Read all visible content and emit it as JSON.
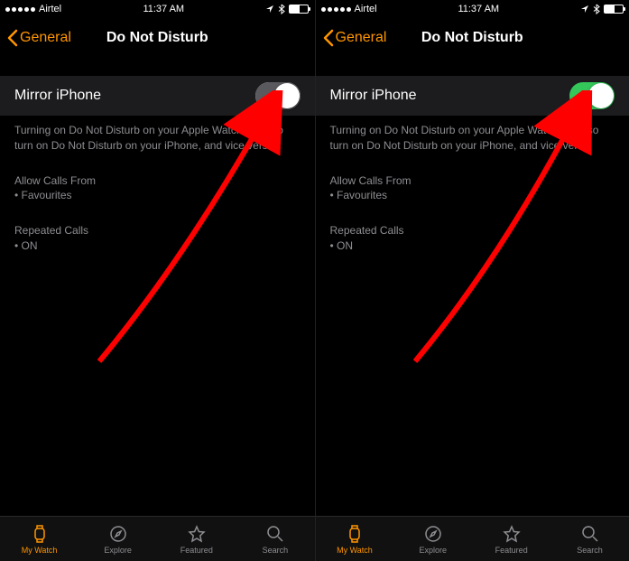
{
  "statusBar": {
    "carrier": "Airtel",
    "time": "11:37 AM",
    "locationIcon": "location-arrow",
    "bluetoothIcon": "bluetooth"
  },
  "nav": {
    "backLabel": "General",
    "title": "Do Not Disturb"
  },
  "toggle": {
    "label": "Mirror iPhone",
    "leftState": "off",
    "rightState": "on"
  },
  "footer": {
    "description": "Turning on Do Not Disturb on your Apple Watch will also turn on Do Not Disturb on your iPhone, and vice versa.",
    "allowCallsLabel": "Allow Calls From",
    "allowCallsValue": "• Favourites",
    "repeatedCallsLabel": "Repeated Calls",
    "repeatedCallsValue": "• ON"
  },
  "tabs": {
    "myWatch": "My Watch",
    "explore": "Explore",
    "featured": "Featured",
    "search": "Search"
  }
}
